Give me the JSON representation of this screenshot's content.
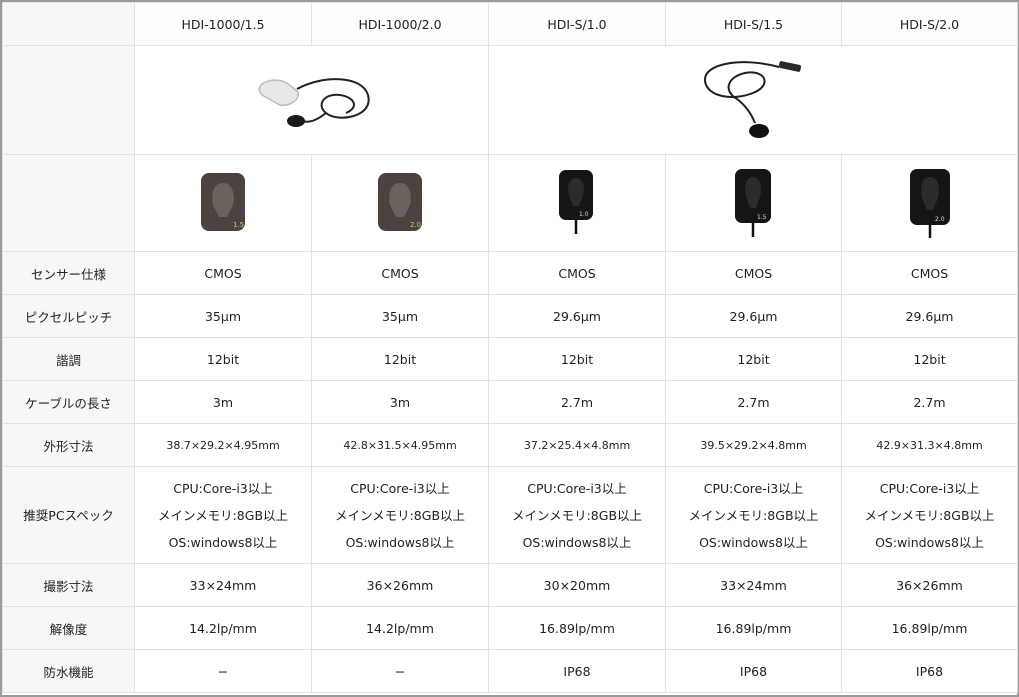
{
  "models": [
    "HDI-1000/1.5",
    "HDI-1000/2.0",
    "HDI-S/1.0",
    "HDI-S/1.5",
    "HDI-S/2.0"
  ],
  "images": {
    "group_1000": "hdi-1000-sensor-with-cable-photo",
    "group_s": "hdi-s-sensor-with-cable-photo",
    "sensors": [
      "sensor-1.5-photo",
      "sensor-2.0-photo",
      "sensor-1.0-photo",
      "sensor-1.5-photo",
      "sensor-2.0-photo"
    ],
    "sensor_marks": [
      "1.5",
      "2.0",
      "1.0",
      "1.5",
      "2.0"
    ]
  },
  "rows": [
    {
      "label": "センサー仕様",
      "values": [
        "CMOS",
        "CMOS",
        "CMOS",
        "CMOS",
        "CMOS"
      ]
    },
    {
      "label": "ピクセルピッチ",
      "values": [
        "35μm",
        "35μm",
        "29.6μm",
        "29.6μm",
        "29.6μm"
      ]
    },
    {
      "label": "諧調",
      "values": [
        "12bit",
        "12bit",
        "12bit",
        "12bit",
        "12bit"
      ]
    },
    {
      "label": "ケーブルの長さ",
      "values": [
        "3m",
        "3m",
        "2.7m",
        "2.7m",
        "2.7m"
      ]
    },
    {
      "label": "外形寸法",
      "values": [
        "38.7×29.2×4.95mm",
        "42.8×31.5×4.95mm",
        "37.2×25.4×4.8mm",
        "39.5×29.2×4.8mm",
        "42.9×31.3×4.8mm"
      ]
    }
  ],
  "pc_spec": {
    "label": "推奨PCスペック",
    "lines": [
      "CPU:Core-i3以上",
      "メインメモリ:8GB以上",
      "OS:windows8以上"
    ]
  },
  "rows_after": [
    {
      "label": "撮影寸法",
      "values": [
        "33×24mm",
        "36×26mm",
        "30×20mm",
        "33×24mm",
        "36×26mm"
      ]
    },
    {
      "label": "解像度",
      "values": [
        "14.2lp/mm",
        "14.2lp/mm",
        "16.89lp/mm",
        "16.89lp/mm",
        "16.89lp/mm"
      ]
    },
    {
      "label": "防水機能",
      "values": [
        "−",
        "−",
        "IP68",
        "IP68",
        "IP68"
      ]
    }
  ]
}
